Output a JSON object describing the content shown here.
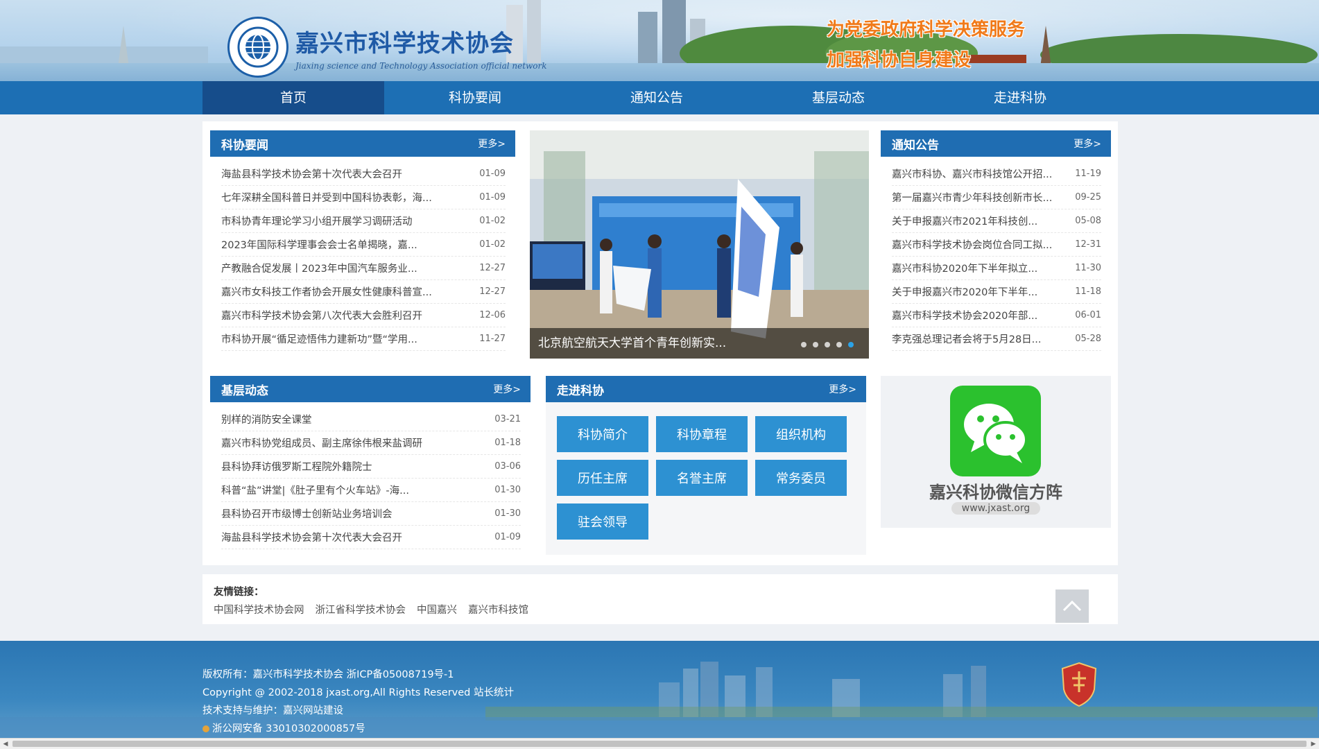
{
  "header": {
    "logo_cn": "嘉兴市科学技术协会",
    "logo_en": "Jiaxing science and Technology Association official network",
    "slogan_line1": "为党委政府科学决策服务",
    "slogan_line2": "加强科协自身建设"
  },
  "nav": {
    "items": [
      "首页",
      "科协要闻",
      "通知公告",
      "基层动态",
      "走进科协"
    ]
  },
  "kxyw": {
    "title": "科协要闻",
    "more": "更多>",
    "items": [
      {
        "t": "海盐县科学技术协会第十次代表大会召开",
        "d": "01-09"
      },
      {
        "t": "七年深耕全国科普日并受到中国科协表彰，海...",
        "d": "01-09"
      },
      {
        "t": "市科协青年理论学习小组开展学习调研活动",
        "d": "01-02"
      },
      {
        "t": "2023年国际科学理事会会士名单揭晓，嘉...",
        "d": "01-02"
      },
      {
        "t": "产教融合促发展丨2023年中国汽车服务业...",
        "d": "12-27"
      },
      {
        "t": "嘉兴市女科技工作者协会开展女性健康科普宣...",
        "d": "12-27"
      },
      {
        "t": "嘉兴市科学技术协会第八次代表大会胜利召开",
        "d": "12-06"
      },
      {
        "t": "市科协开展“循足迹悟伟力建新功”暨“学用...",
        "d": "11-27"
      }
    ]
  },
  "carousel": {
    "caption": "北京航空航天大学首个青年创新实...",
    "dot_count": 5,
    "active_dot": 5
  },
  "tzgg": {
    "title": "通知公告",
    "more": "更多>",
    "items": [
      {
        "t": "嘉兴市科协、嘉兴市科技馆公开招...",
        "d": "11-19"
      },
      {
        "t": "第一届嘉兴市青少年科技创新市长...",
        "d": "09-25"
      },
      {
        "t": "关于申报嘉兴市2021年科技创...",
        "d": "05-08"
      },
      {
        "t": "嘉兴市科学技术协会岗位合同工拟...",
        "d": "12-31"
      },
      {
        "t": "嘉兴市科协2020年下半年拟立...",
        "d": "11-30"
      },
      {
        "t": "关于申报嘉兴市2020年下半年...",
        "d": "11-18"
      },
      {
        "t": "嘉兴市科学技术协会2020年部...",
        "d": "06-01"
      },
      {
        "t": "李克强总理记者会将于5月28日...",
        "d": "05-28"
      }
    ]
  },
  "jcdt": {
    "title": "基层动态",
    "more": "更多>",
    "items": [
      {
        "t": "别样的消防安全课堂",
        "d": "03-21"
      },
      {
        "t": "嘉兴市科协党组成员、副主席徐伟根来盐调研",
        "d": "01-18"
      },
      {
        "t": "县科协拜访俄罗斯工程院外籍院士",
        "d": "03-06"
      },
      {
        "t": "科普“盐”讲堂|《肚子里有个火车站》-海...",
        "d": "01-30"
      },
      {
        "t": "县科协召开市级博士创新站业务培训会",
        "d": "01-30"
      },
      {
        "t": "海盐县科学技术协会第十次代表大会召开",
        "d": "01-09"
      }
    ]
  },
  "zjkx": {
    "title": "走进科协",
    "more": "更多>",
    "tiles": [
      "科协简介",
      "科协章程",
      "组织机构",
      "历任主席",
      "名誉主席",
      "常务委员",
      "驻会领导"
    ]
  },
  "wechat": {
    "title": "嘉兴科协微信方阵",
    "url": "www.jxast.org"
  },
  "links": {
    "title": "友情链接：",
    "items": [
      "中国科学技术协会网",
      "浙江省科学技术协会",
      "中国嘉兴",
      "嘉兴市科技馆"
    ]
  },
  "footer": {
    "line1": "版权所有：嘉兴市科学技术协会 浙ICP备05008719号-1",
    "line2": "Copyright @ 2002-2018 jxast.org,All Rights Reserved 站长统计",
    "line3": "技术支持与维护：嘉兴网站建设",
    "line4": "浙公网安备 33010302000857号"
  }
}
